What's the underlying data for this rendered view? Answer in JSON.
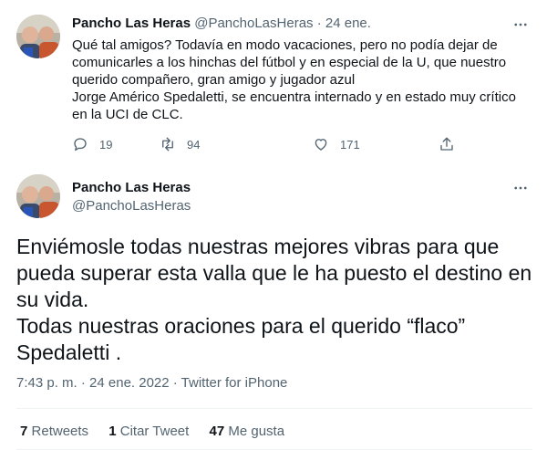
{
  "tweet1": {
    "author_name": "Pancho Las Heras",
    "handle": "@PanchoLasHeras",
    "separator": "·",
    "date": "24 ene.",
    "text": "Qué tal amigos? Todavía en modo vacaciones, pero no podía dejar de\ncomunicarles a los hinchas del fútbol y en especial de la U, que nuestro\nquerido compañero, gran amigo y jugador azul\nJorge Américo Spedaletti, se encuentra internado y en estado muy crítico\nen la UCI de CLC.",
    "replies": "19",
    "retweets": "94",
    "likes": "171"
  },
  "tweet2": {
    "author_name": "Pancho Las Heras",
    "handle": "@PanchoLasHeras",
    "text": "Enviémosle todas nuestras mejores vibras para que\npueda superar esta valla que le ha puesto el destino en\nsu vida.\nTodas nuestras oraciones para el querido “flaco”\nSpedaletti .",
    "meta": "7:43 p. m. · 24 ene. 2022 · Twitter for iPhone",
    "stats": {
      "retweets_count": "7",
      "retweets_label": "Retweets",
      "quotes_count": "1",
      "quotes_label": "Citar Tweet",
      "likes_count": "47",
      "likes_label": "Me gusta"
    }
  },
  "colors": {
    "text_primary": "#0f1419",
    "text_secondary": "#536471",
    "divider": "#eff3f4"
  },
  "icons": [
    "more-icon",
    "reply-icon",
    "retweet-icon",
    "like-icon",
    "share-icon"
  ]
}
